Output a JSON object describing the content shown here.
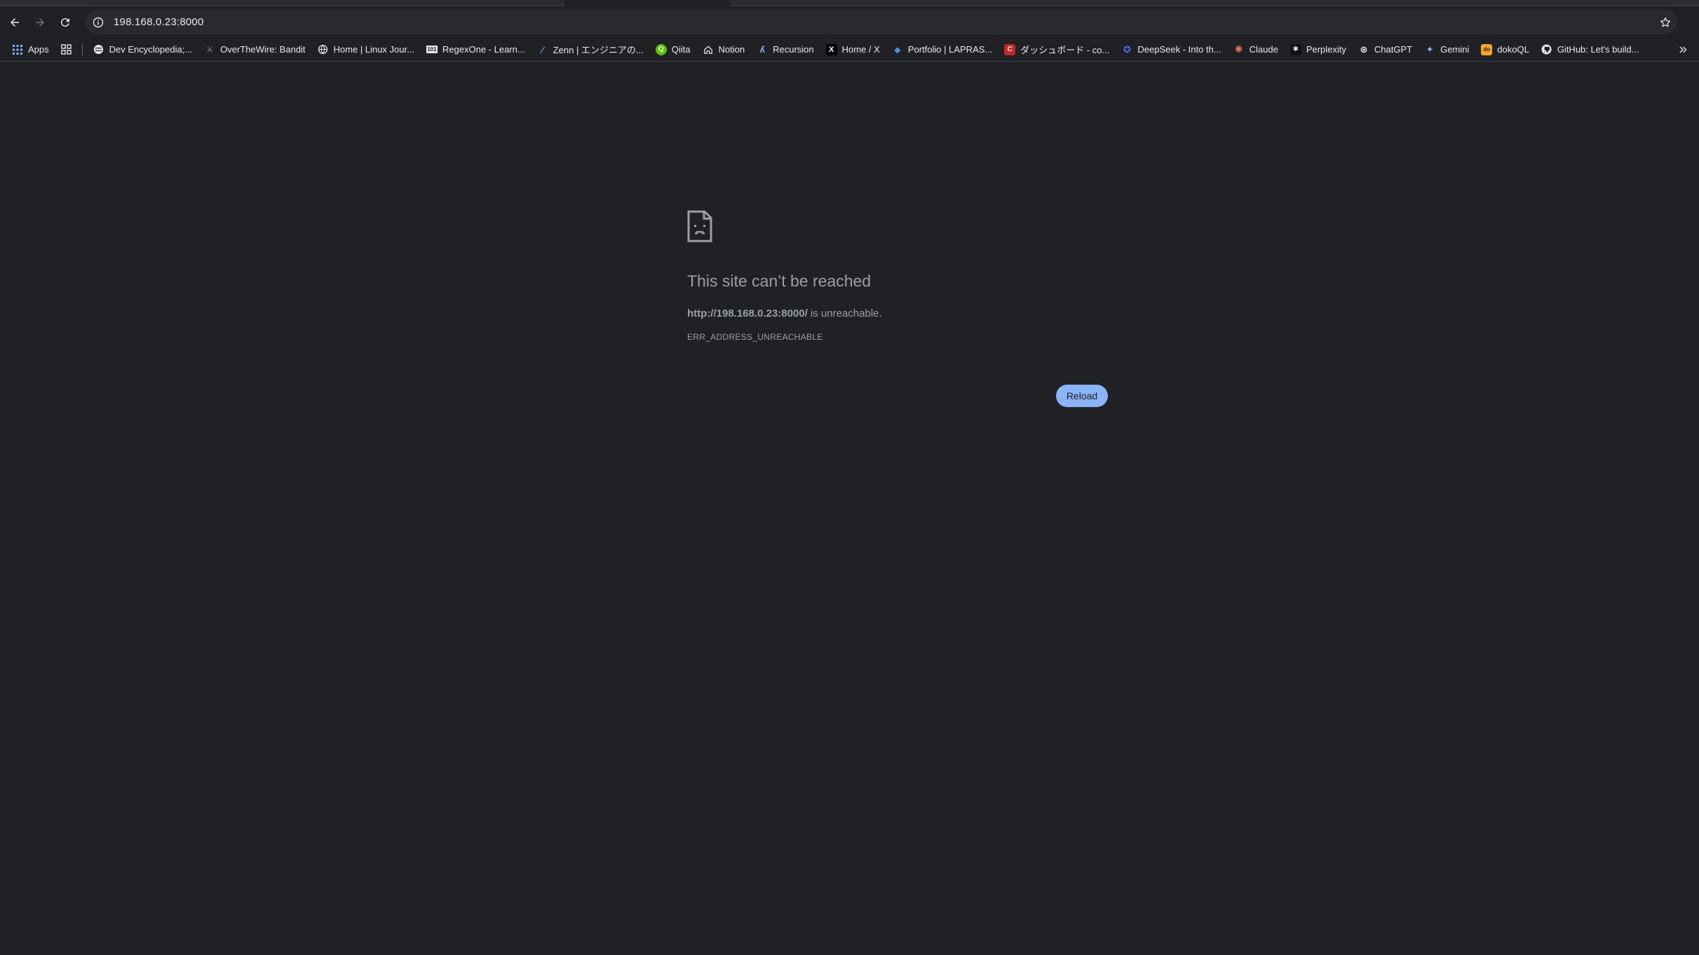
{
  "browser": {
    "url": "198.168.0.23:8000"
  },
  "bookmarks": {
    "apps_label": "Apps",
    "items": [
      {
        "label": "Dev Encyclopedia;...",
        "icon": "globe-icon"
      },
      {
        "label": "OverTheWire: Bandit",
        "icon": "bandit-icon"
      },
      {
        "label": "Home | Linux Jour...",
        "icon": "globe-icon"
      },
      {
        "label": "RegexOne - Learn...",
        "icon": "regexone-icon"
      },
      {
        "label": "Zenn | エンジニアの...",
        "icon": "zenn-icon"
      },
      {
        "label": "Qiita",
        "icon": "qiita-icon"
      },
      {
        "label": "Notion",
        "icon": "home-icon"
      },
      {
        "label": "Recursion",
        "icon": "recursion-icon"
      },
      {
        "label": "Home / X",
        "icon": "x-icon"
      },
      {
        "label": "Portfolio | LAPRAS...",
        "icon": "lapras-icon"
      },
      {
        "label": "ダッシュボード - co...",
        "icon": "c-icon"
      },
      {
        "label": "DeepSeek - Into th...",
        "icon": "deepseek-icon"
      },
      {
        "label": "Claude",
        "icon": "claude-icon"
      },
      {
        "label": "Perplexity",
        "icon": "perplexity-icon"
      },
      {
        "label": "ChatGPT",
        "icon": "chatgpt-icon"
      },
      {
        "label": "Gemini",
        "icon": "gemini-icon"
      },
      {
        "label": "dokoQL",
        "icon": "dokoql-icon"
      },
      {
        "label": "GitHub: Let's build...",
        "icon": "github-icon"
      }
    ]
  },
  "error": {
    "title": "This site can’t be reached",
    "url": "http://198.168.0.23:8000/",
    "message_suffix": " is unreachable.",
    "code": "ERR_ADDRESS_UNREACHABLE",
    "reload_label": "Reload"
  },
  "colors": {
    "background": "#202124",
    "accent": "#8ab4f8",
    "muted_text": "#9aa0a6"
  }
}
